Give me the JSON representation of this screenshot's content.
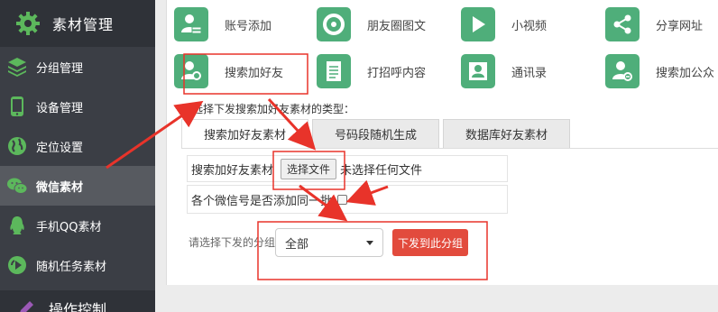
{
  "sidebar": {
    "header_title": "素材管理",
    "items": [
      {
        "label": "分组管理",
        "icon": "layers-icon"
      },
      {
        "label": "设备管理",
        "icon": "phone-icon"
      },
      {
        "label": "定位设置",
        "icon": "globe-icon"
      },
      {
        "label": "微信素材",
        "icon": "wechat-icon",
        "active": true
      },
      {
        "label": "手机QQ素材",
        "icon": "qq-icon"
      },
      {
        "label": "随机任务素材",
        "icon": "random-task-icon"
      }
    ],
    "bottom_title": "操作控制"
  },
  "tiles": [
    {
      "label": "账号添加",
      "icon": "add-user-icon"
    },
    {
      "label": "朋友圈图文",
      "icon": "moments-icon"
    },
    {
      "label": "小视频",
      "icon": "play-icon"
    },
    {
      "label": "分享网址",
      "icon": "share-icon"
    },
    {
      "label": "搜索加好友",
      "icon": "search-friend-icon"
    },
    {
      "label": "打招呼内容",
      "icon": "document-icon"
    },
    {
      "label": "通讯录",
      "icon": "contacts-icon"
    },
    {
      "label": "搜索加公众",
      "icon": "search-official-icon"
    }
  ],
  "prompt": "请选择下发搜索加好友素材的类型：",
  "tabs": [
    "搜索加好友素材",
    "号码段随机生成",
    "数据库好友素材"
  ],
  "file_row": {
    "label": "搜索加好友素材",
    "button": "选择文件",
    "status": "未选择任何文件"
  },
  "checkbox_row": {
    "label": "各个微信号是否添加同一批"
  },
  "group": {
    "label": "请选择下发的分组",
    "selected": "全部",
    "send_button": "下发到此分组"
  },
  "colors": {
    "sidebar": "#3b3e45",
    "tile_green": "#4fae7a",
    "send_red": "#e24b3d",
    "annotation_red": "#e8332a"
  }
}
